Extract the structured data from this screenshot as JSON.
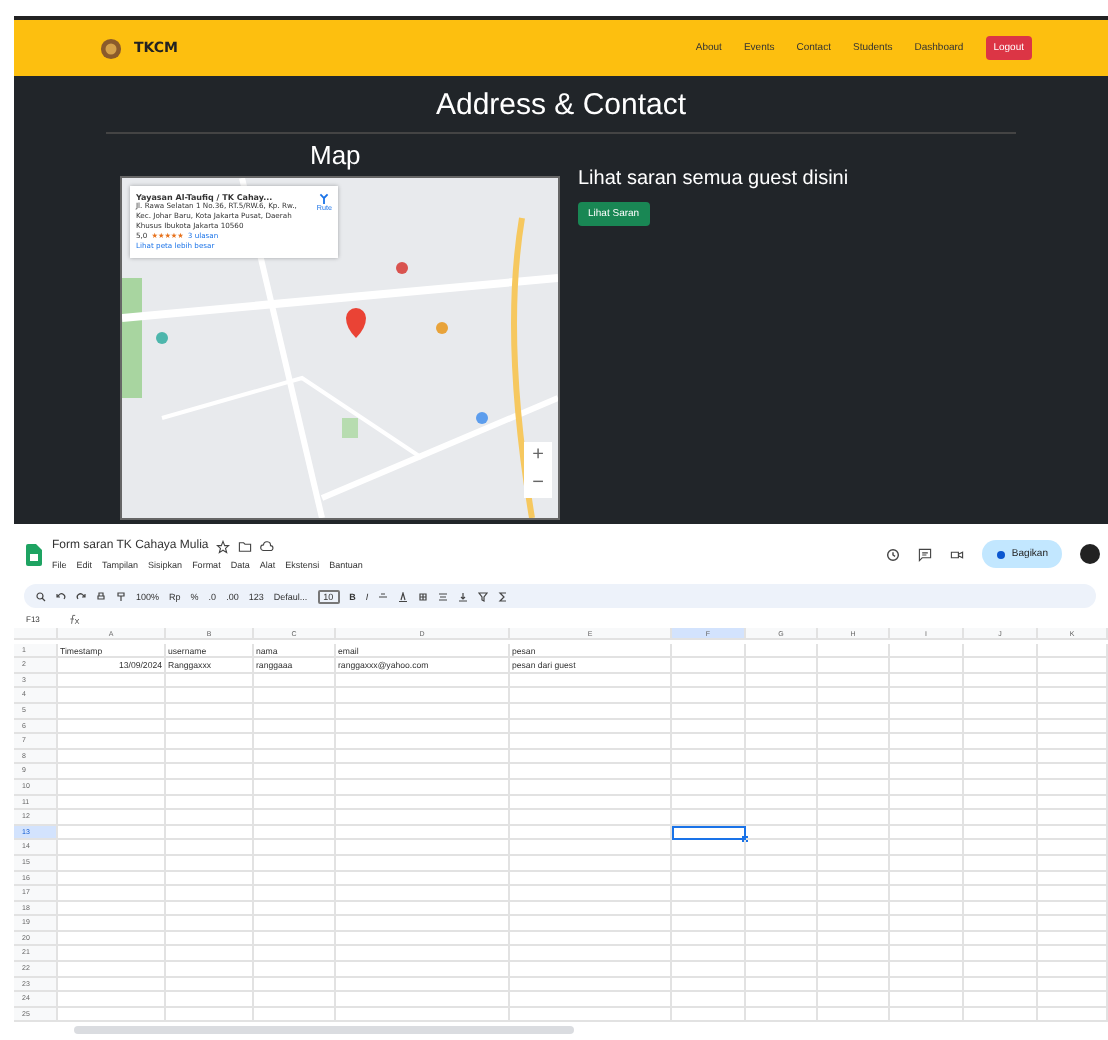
{
  "navbar": {
    "brand": "TKCM",
    "links": [
      {
        "label": "About"
      },
      {
        "label": "Events"
      },
      {
        "label": "Contact"
      },
      {
        "label": "Students"
      },
      {
        "label": "Dashboard"
      }
    ],
    "logout": "Logout"
  },
  "section": {
    "title": "Address & Contact",
    "map_heading": "Map",
    "map": {
      "kind": "picture",
      "place_card": {
        "name": "Yayasan Al-Taufiq / TK Cahay...",
        "address": "Jl. Rawa Selatan 1 No.36, RT.5/RW.6, Kp. Rw., Kec. Johar Baru, Kota Jakarta Pusat, Daerah Khusus Ibukota Jakarta 10560",
        "rating": "5,0",
        "stars": 5,
        "reviews": "3 ulasan",
        "larger_map_link": "Lihat peta lebih besar",
        "directions": "Rute"
      },
      "zoom_in": "+",
      "zoom_out": "−"
    },
    "guest_text": "Lihat saran semua guest disini",
    "guest_button": "Lihat Saran"
  },
  "sheet": {
    "title": "Form saran TK Cahaya Mulia",
    "menu": [
      "File",
      "Edit",
      "Tampilan",
      "Sisipkan",
      "Format",
      "Data",
      "Alat",
      "Ekstensi",
      "Bantuan"
    ],
    "share_button": "Bagikan",
    "toolbar": {
      "zoom": "100%",
      "currency": "Rp",
      "percent": "%",
      "decrease_decimal": ".0",
      "increase_decimal": ".00",
      "number_format": "123",
      "font": "Defaul...",
      "font_size": "10",
      "bold": "B",
      "italic": "I"
    },
    "name_box": "F13",
    "columns": [
      {
        "label": "A",
        "selected": false
      },
      {
        "label": "B",
        "selected": false
      },
      {
        "label": "C",
        "selected": false
      },
      {
        "label": "D",
        "selected": false
      },
      {
        "label": "E",
        "selected": false
      },
      {
        "label": "F",
        "selected": true
      },
      {
        "label": "G",
        "selected": false
      },
      {
        "label": "H",
        "selected": false
      },
      {
        "label": "I",
        "selected": false
      },
      {
        "label": "J",
        "selected": false
      },
      {
        "label": "K",
        "selected": false
      }
    ],
    "rows": [
      {
        "number": "1",
        "selected": false,
        "cells": [
          "Timestamp",
          "username",
          "nama",
          "email",
          "pesan"
        ]
      },
      {
        "number": "2",
        "selected": false,
        "cells": [
          "13/09/2024",
          "Ranggaxxx",
          "ranggaaa",
          "ranggaxxx@yahoo.com",
          "pesan dari guest"
        ]
      },
      {
        "number": "3",
        "selected": false,
        "cells": []
      },
      {
        "number": "4",
        "selected": false,
        "cells": []
      },
      {
        "number": "5",
        "selected": false,
        "cells": []
      },
      {
        "number": "6",
        "selected": false,
        "cells": []
      },
      {
        "number": "7",
        "selected": false,
        "cells": []
      },
      {
        "number": "8",
        "selected": false,
        "cells": []
      },
      {
        "number": "9",
        "selected": false,
        "cells": []
      },
      {
        "number": "10",
        "selected": false,
        "cells": []
      },
      {
        "number": "11",
        "selected": false,
        "cells": []
      },
      {
        "number": "12",
        "selected": false,
        "cells": []
      },
      {
        "number": "13",
        "selected": true,
        "cells": []
      },
      {
        "number": "14",
        "selected": false,
        "cells": []
      },
      {
        "number": "15",
        "selected": false,
        "cells": []
      },
      {
        "number": "16",
        "selected": false,
        "cells": []
      },
      {
        "number": "17",
        "selected": false,
        "cells": []
      },
      {
        "number": "18",
        "selected": false,
        "cells": []
      },
      {
        "number": "19",
        "selected": false,
        "cells": []
      },
      {
        "number": "20",
        "selected": false,
        "cells": []
      },
      {
        "number": "21",
        "selected": false,
        "cells": []
      },
      {
        "number": "22",
        "selected": false,
        "cells": []
      },
      {
        "number": "23",
        "selected": false,
        "cells": []
      },
      {
        "number": "24",
        "selected": false,
        "cells": []
      },
      {
        "number": "25",
        "selected": false,
        "cells": []
      }
    ]
  }
}
